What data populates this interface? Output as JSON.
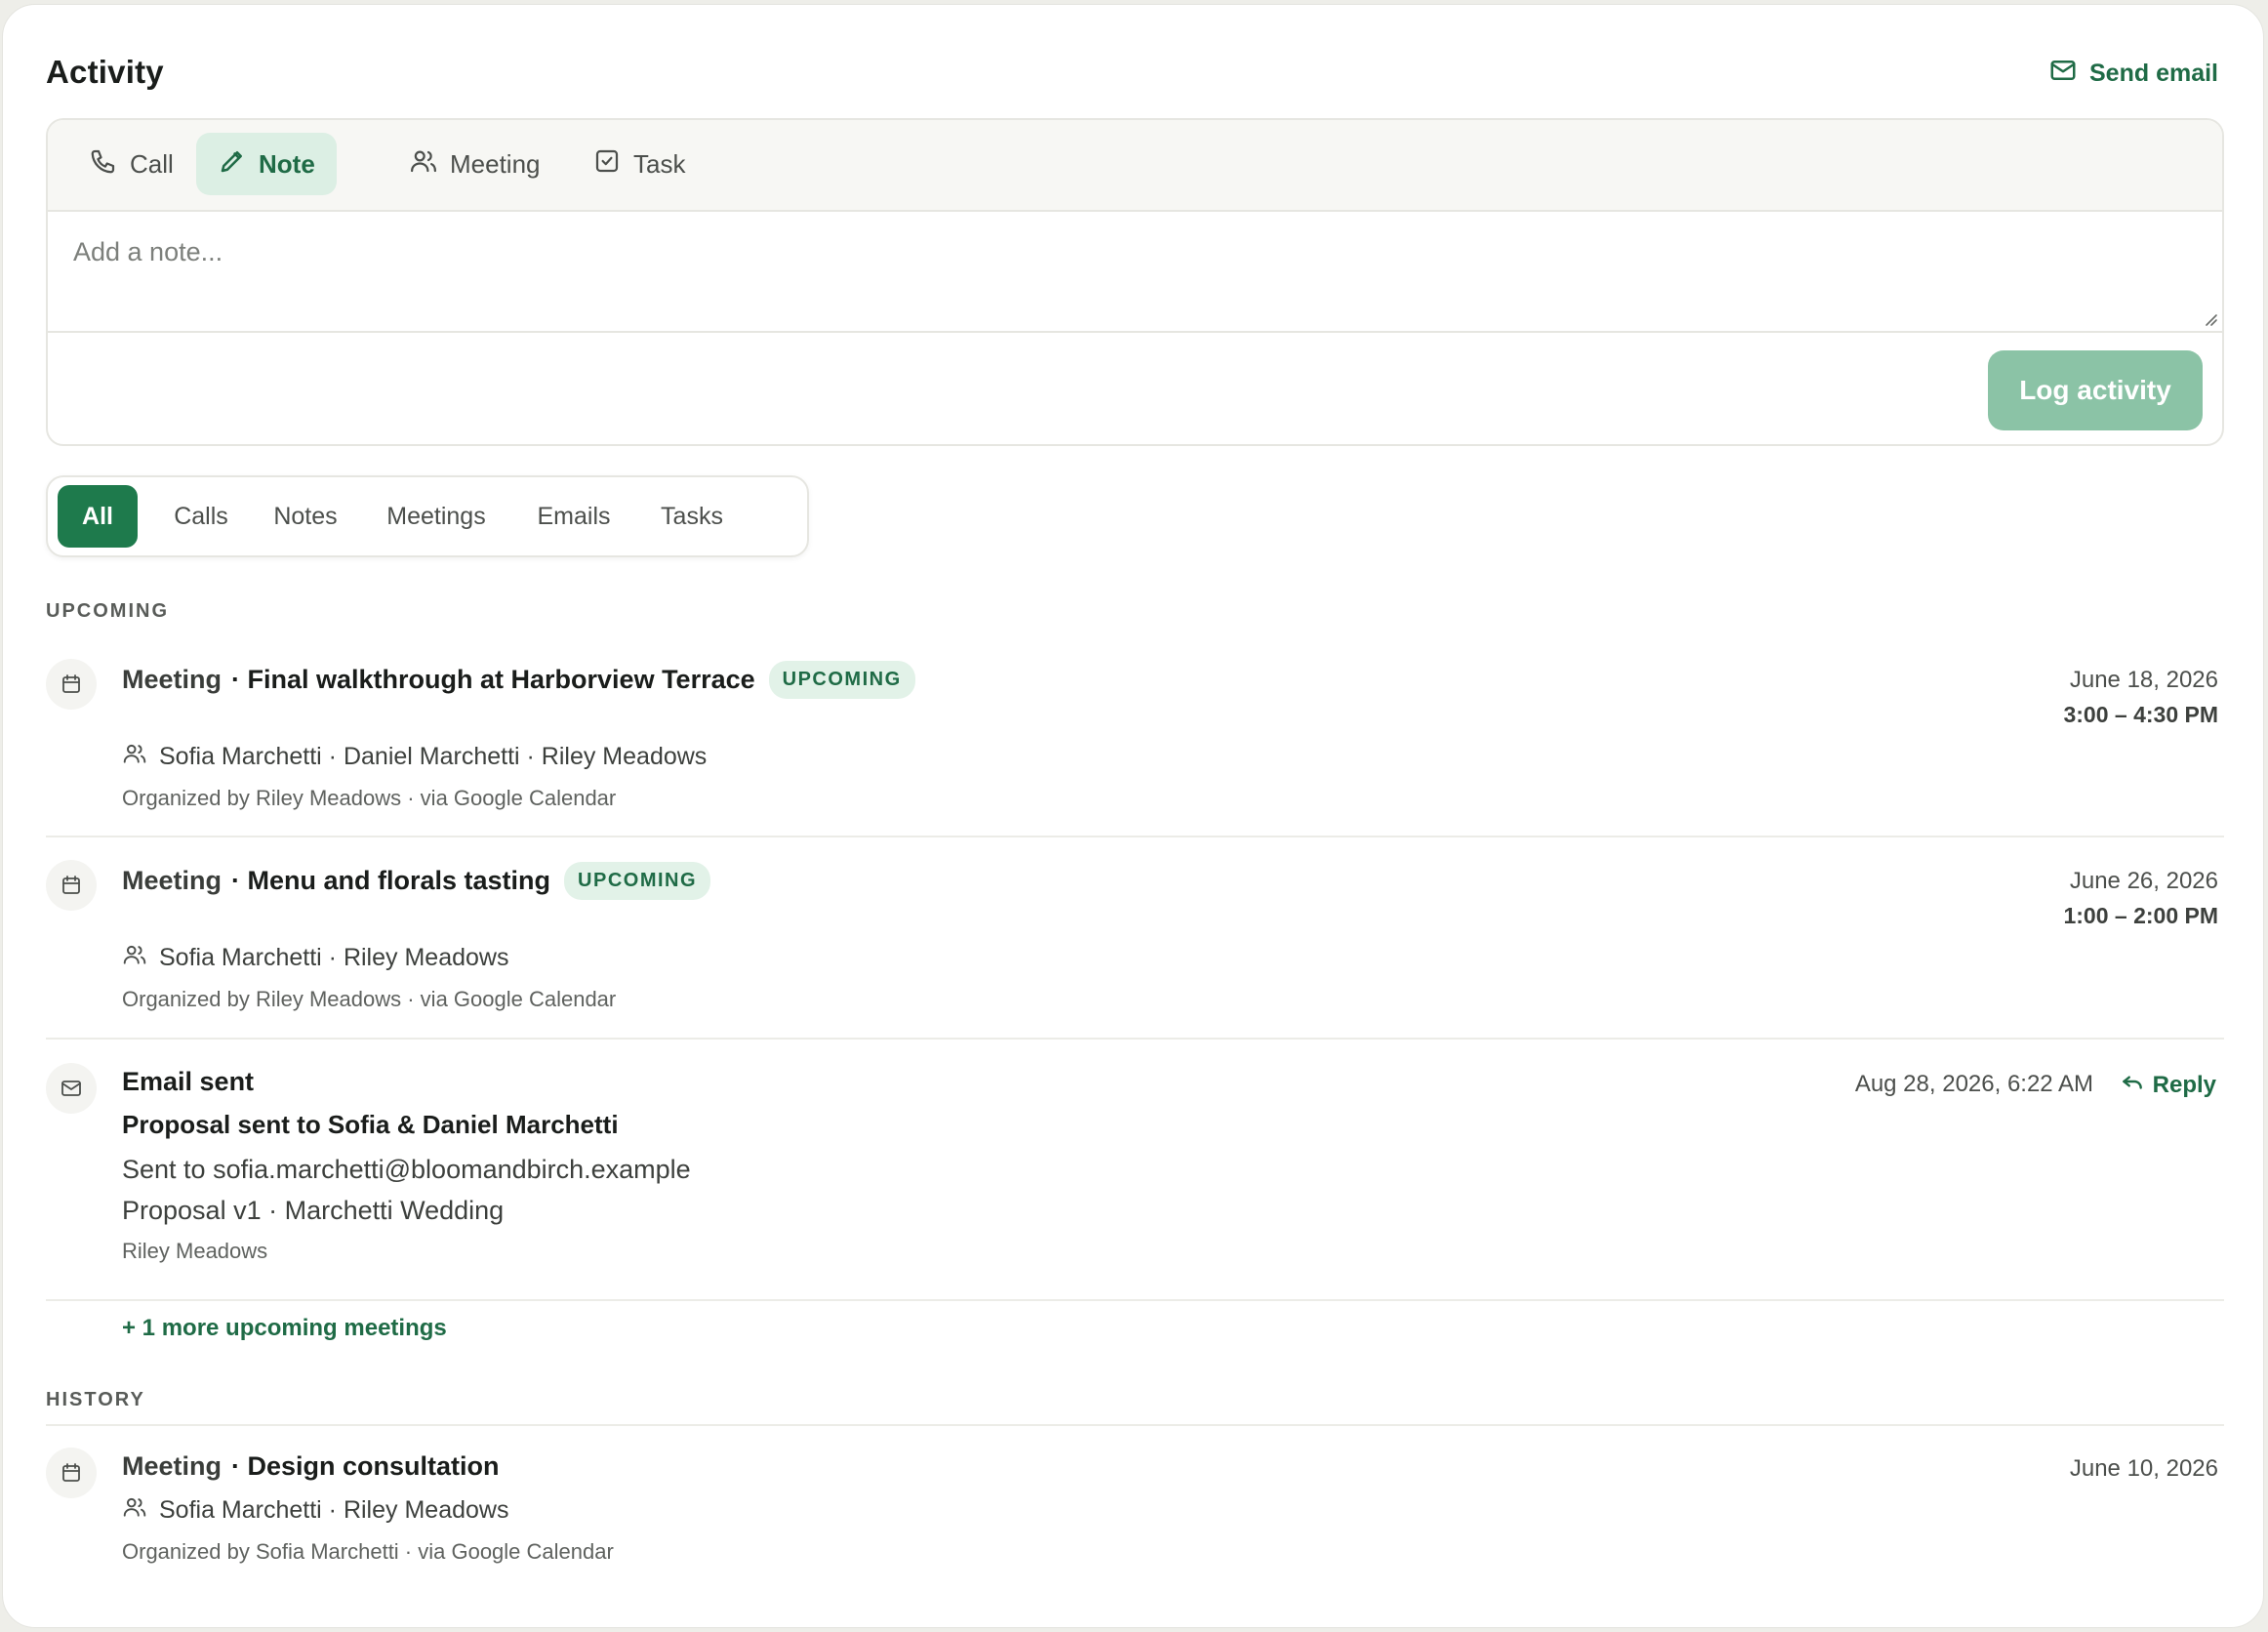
{
  "header": {
    "title": "Activity",
    "send_email_label": "Send email"
  },
  "composer": {
    "tabs": [
      {
        "label": "Call",
        "icon": "phone-icon"
      },
      {
        "label": "Note",
        "icon": "pencil-icon",
        "active": true
      },
      {
        "label": "Meeting",
        "icon": "people-icon"
      },
      {
        "label": "Task",
        "icon": "checkbox-icon"
      }
    ],
    "placeholder": "Add a note...",
    "log_button_label": "Log activity"
  },
  "filters": {
    "tabs": [
      "All",
      "Calls",
      "Notes",
      "Meetings",
      "Emails",
      "Tasks"
    ],
    "active": "All"
  },
  "upcoming": {
    "label": "UPCOMING",
    "items": [
      {
        "kind": "Meeting",
        "title": "· Final walkthrough at Harborview Terrace",
        "badge": "UPCOMING",
        "attendees": "Sofia Marchetti · Daniel Marchetti · Riley Meadows",
        "organizer": "Organized by Riley Meadows · via Google Calendar",
        "date": "June 18, 2026",
        "time": "3:00 – 4:30 PM"
      },
      {
        "kind": "Meeting",
        "title": "· Menu and florals tasting",
        "badge": "UPCOMING",
        "attendees": "Sofia Marchetti · Riley Meadows",
        "organizer": "Organized by Riley Meadows · via Google Calendar",
        "date": "June 26, 2026",
        "time": "1:00 – 2:00 PM"
      }
    ],
    "email": {
      "kind": "Email sent",
      "subject": "Proposal sent to Sofia & Daniel Marchetti",
      "to_line": "Sent to sofia.marchetti@bloomandbirch.example",
      "attachment_line": "Proposal v1 · Marchetti Wedding",
      "sender": "Riley Meadows",
      "timestamp": "Aug 28, 2026, 6:22 AM",
      "reply_label": "Reply"
    },
    "more_link": "+ 1 more upcoming meetings"
  },
  "history": {
    "label": "HISTORY",
    "items": [
      {
        "kind": "Meeting",
        "title": "· Design consultation",
        "attendees": "Sofia Marchetti · Riley Meadows",
        "organizer": "Organized by Sofia Marchetti · via Google Calendar",
        "date": "June 10, 2026"
      }
    ]
  },
  "colors": {
    "accent": "#1e7a4c",
    "accent_soft": "#dcefe4",
    "button_disabled": "#8bc3a6"
  }
}
